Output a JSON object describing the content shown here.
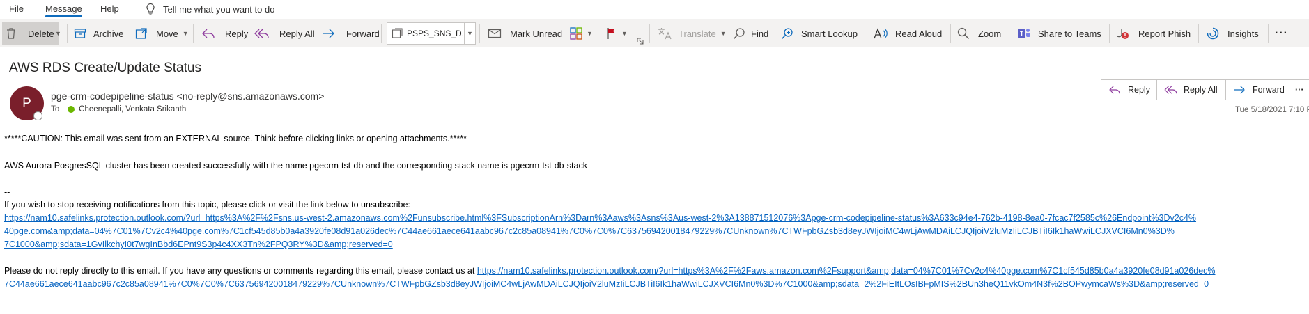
{
  "menu": {
    "file": "File",
    "message": "Message",
    "help": "Help",
    "tell_me": "Tell me what you want to do"
  },
  "ribbon": {
    "delete": "Delete",
    "archive": "Archive",
    "move": "Move",
    "reply": "Reply",
    "reply_all": "Reply All",
    "forward": "Forward",
    "quick_step": "PSPS_SNS_D...",
    "mark_unread": "Mark Unread",
    "translate": "Translate",
    "find": "Find",
    "smart_lookup": "Smart Lookup",
    "read_aloud": "Read Aloud",
    "zoom": "Zoom",
    "share_to_teams": "Share to Teams",
    "report_phish": "Report Phish",
    "insights": "Insights",
    "more": "···"
  },
  "email": {
    "subject": "AWS RDS Create/Update Status",
    "avatar_initial": "P",
    "sender": "pge-crm-codepipeline-status <no-reply@sns.amazonaws.com>",
    "to_label": "To",
    "recipient": "Cheenepalli, Venkata Srikanth",
    "date": "Tue 5/18/2021 7:10 P",
    "actions": {
      "reply": "Reply",
      "reply_all": "Reply All",
      "forward": "Forward",
      "more": "···"
    },
    "caution": "*****CAUTION: This email was sent from an EXTERNAL source. Think before clicking links or opening attachments.*****",
    "message": "AWS Aurora PosgresSQL cluster has been created successfully with the name pgecrm-tst-db and the corresponding stack name is  pgecrm-tst-db-stack",
    "dashes": "--",
    "unsubscribe_text": "If you wish to stop receiving notifications from this topic, please click or visit the link below to unsubscribe:",
    "unsubscribe_link_1": "https://nam10.safelinks.protection.outlook.com/?url=https%3A%2F%2Fsns.us-west-2.amazonaws.com%2Funsubscribe.html%3FSubscriptionArn%3Darn%3Aaws%3Asns%3Aus-west-2%3A138871512076%3Apge-crm-codepipeline-status%3A633c94e4-762b-4198-8ea0-7fcac7f2585c%26Endpoint%3Dv2c4%",
    "unsubscribe_link_2": "40pge.com&amp;data=04%7C01%7Cv2c4%40pge.com%7C1cf545d85b0a4a3920fe08d91a026dec%7C44ae661aece641aabc967c2c85a08941%7C0%7C0%7C637569420018479229%7CUnknown%7CTWFpbGZsb3d8eyJWIjoiMC4wLjAwMDAiLCJQIjoiV2luMzIiLCJBTiI6Ik1haWwiLCJXVCI6Mn0%3D%",
    "unsubscribe_link_3": "7C1000&amp;sdata=1GvIlkchyI0t7wgInBbd6EPnt9S3p4c4XX3Tn%2FPQ3RY%3D&amp;reserved=0",
    "contact_text": "Please do not reply directly to this email. If you have any questions or comments regarding this email, please contact us at ",
    "contact_link_1": "https://nam10.safelinks.protection.outlook.com/?url=https%3A%2F%2Faws.amazon.com%2Fsupport&amp;data=04%7C01%7Cv2c4%40pge.com%7C1cf545d85b0a4a3920fe08d91a026dec%",
    "contact_link_2": "7C44ae661aece641aabc967c2c85a08941%7C0%7C0%7C637569420018479229%7CUnknown%7CTWFpbGZsb3d8eyJWIjoiMC4wLjAwMDAiLCJQIjoiV2luMzIiLCJBTiI6Ik1haWwiLCJXVCI6Mn0%3D%7C1000&amp;sdata=2%2FiEItLOsIBFpMIS%2BUn3heQ11vkOm4N3f%2BOPwymcaWs%3D&amp;reserved=0"
  },
  "colors": {
    "accent": "#0f6cbd",
    "avatar": "#7a1f2b",
    "link": "#0563c1",
    "ribbon_bg": "#f3f2f1"
  }
}
